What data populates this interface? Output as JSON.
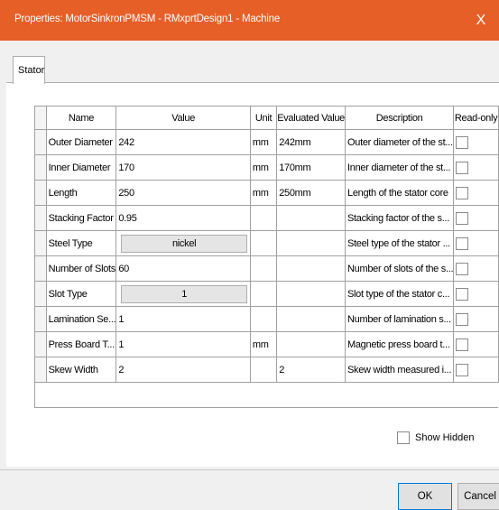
{
  "window": {
    "title": "Properties: MotorSinkronPMSM - RMxprtDesign1 - Machine",
    "close_label": "X"
  },
  "tabs": [
    {
      "label": "Stator"
    }
  ],
  "grid": {
    "columns": [
      "Name",
      "Value",
      "Unit",
      "Evaluated Value",
      "Description",
      "Read-only"
    ],
    "rows": [
      {
        "name": "Outer Diameter",
        "value": "242",
        "unit": "mm",
        "evaluated": "242mm",
        "description": "Outer diameter of the st..."
      },
      {
        "name": "Inner Diameter",
        "value": "170",
        "unit": "mm",
        "evaluated": "170mm",
        "description": "Inner diameter of the st..."
      },
      {
        "name": "Length",
        "value": "250",
        "unit": "mm",
        "evaluated": "250mm",
        "description": "Length of the stator core"
      },
      {
        "name": "Stacking Factor",
        "value": "0.95",
        "unit": "",
        "evaluated": "",
        "description": "Stacking factor of the s..."
      },
      {
        "name": "Steel Type",
        "value": "nickel",
        "unit": "",
        "evaluated": "",
        "description": "Steel type of the stator ..."
      },
      {
        "name": "Number of Slots",
        "value": "60",
        "unit": "",
        "evaluated": "",
        "description": "Number of slots of the s..."
      },
      {
        "name": "Slot Type",
        "value": "1",
        "unit": "",
        "evaluated": "",
        "description": "Slot type of the stator c..."
      },
      {
        "name": "Lamination Se...",
        "value": "1",
        "unit": "",
        "evaluated": "",
        "description": "Number of lamination s..."
      },
      {
        "name": "Press Board T...",
        "value": "1",
        "unit": "mm",
        "evaluated": "",
        "description": "Magnetic press board t..."
      },
      {
        "name": "Skew Width",
        "value": "2",
        "unit": "",
        "evaluated": "2",
        "description": "Skew width measured i..."
      }
    ]
  },
  "show_hidden_label": "Show Hidden",
  "buttons": {
    "ok": "OK",
    "cancel": "Cancel"
  }
}
